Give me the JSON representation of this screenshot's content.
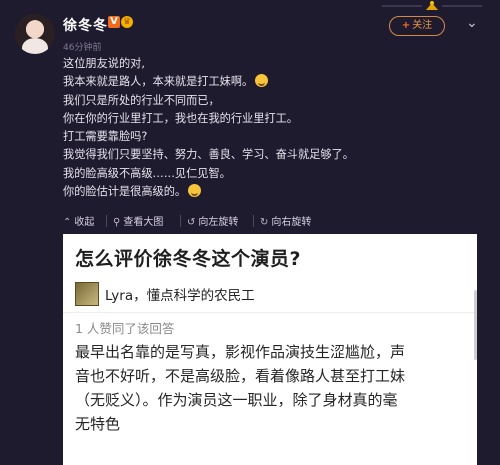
{
  "post": {
    "username": "徐冬冬",
    "verified_badge": "V",
    "time": "46分钟前",
    "follow_label": "关注",
    "more_icon": "chevron-down-icon",
    "lines": [
      "这位朋友说的对,",
      "我本来就是路人，本来就是打工妹啊。",
      "我们只是所处的行业不同而已，",
      "你在你的行业里打工，我也在我的行业里打工。",
      "打工需要靠脸吗?",
      "我觉得我们只要坚持、努力、善良、学习、奋斗就足够了。",
      "我的脸高级不高级……见仁见智。",
      "你的脸估计是很高级的。"
    ]
  },
  "toolbar": {
    "collapse": "收起",
    "view_large": "查看大图",
    "rotate_left": "向左旋转",
    "rotate_right": "向右旋转"
  },
  "embed": {
    "question_title": "怎么评价徐冬冬这个演员?",
    "author": "Lyra，懂点科学的农民工",
    "likes": "1 人赞同了该回答",
    "answer_lines": [
      "最早出名靠的是写真，影视作品演技生涩尴尬，声",
      "音也不好听，不是高级脸，看着像路人甚至打工妹",
      "（无贬义）。作为演员这一职业，除了身材真的毫",
      "无特色"
    ]
  },
  "colors": {
    "background": "#1f1b2e",
    "accent": "#e79447",
    "text": "#e6e3ee"
  }
}
